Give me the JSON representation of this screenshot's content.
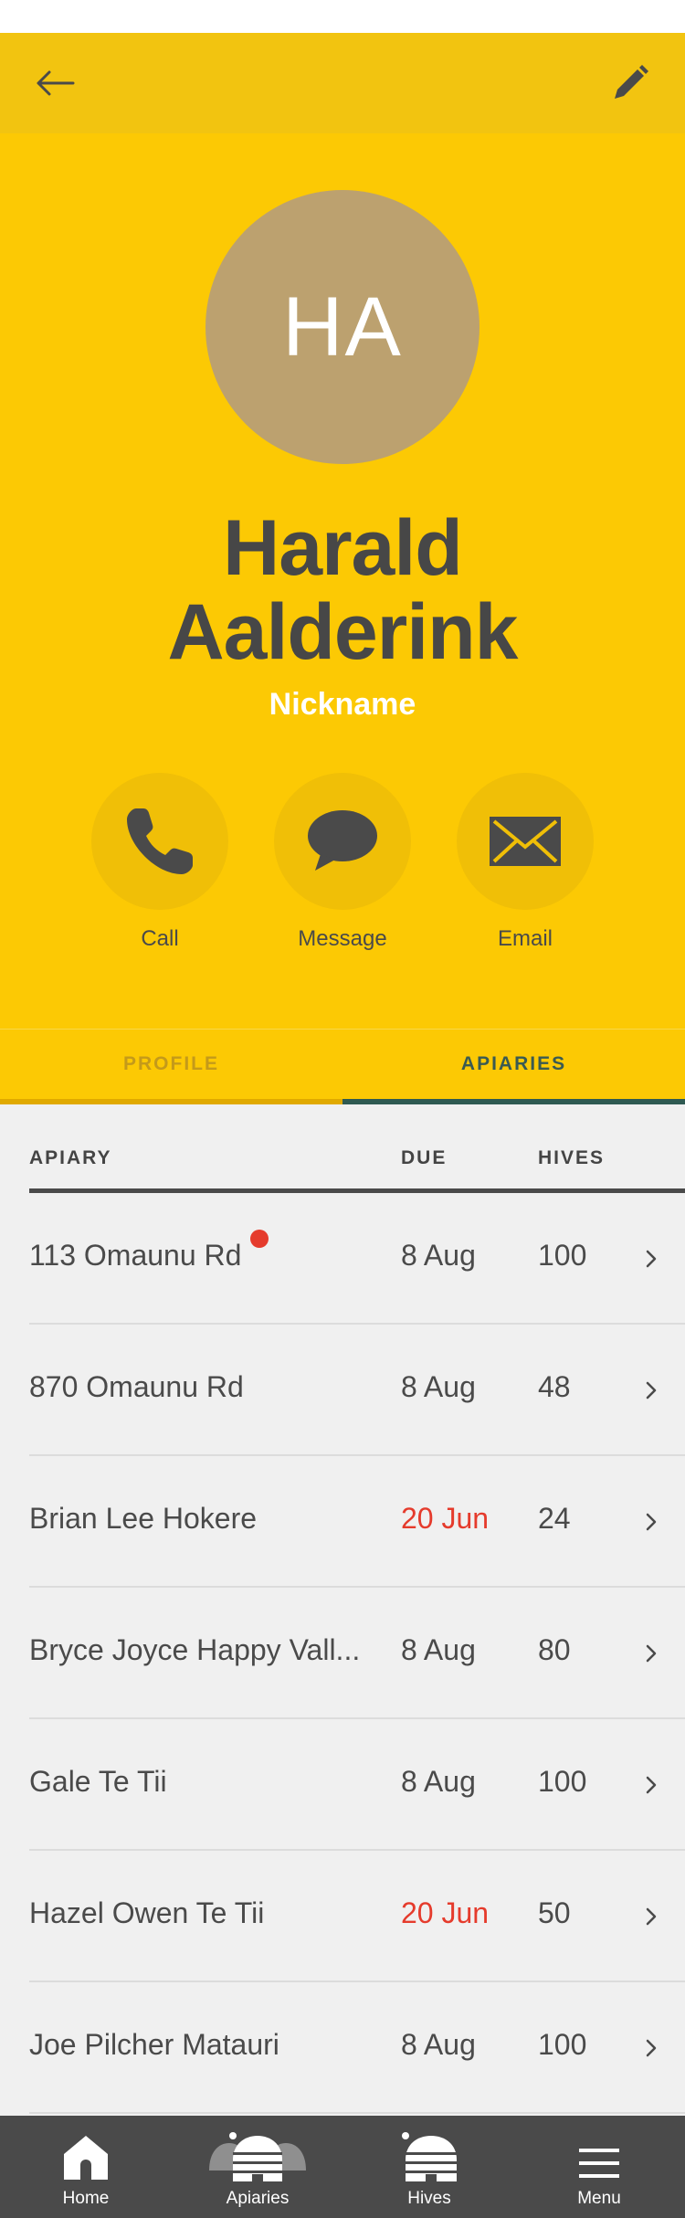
{
  "header": {
    "back_icon": "arrow-left-icon",
    "edit_icon": "pencil-icon"
  },
  "profile": {
    "initials": "HA",
    "first_name": "Harald",
    "last_name": "Aalderink",
    "nickname": "Nickname"
  },
  "actions": [
    {
      "label": "Call",
      "icon": "phone-icon"
    },
    {
      "label": "Message",
      "icon": "speech-bubble-icon"
    },
    {
      "label": "Email",
      "icon": "envelope-icon"
    }
  ],
  "tabs": {
    "profile": "PROFILE",
    "apiaries": "APIARIES",
    "active": "apiaries"
  },
  "table": {
    "columns": {
      "apiary": "APIARY",
      "due": "DUE",
      "hives": "HIVES"
    },
    "rows": [
      {
        "name": "113 Omaunu Rd",
        "due": "8 Aug",
        "hives": "100",
        "overdue": false,
        "alert": true
      },
      {
        "name": "870 Omaunu Rd",
        "due": "8 Aug",
        "hives": "48",
        "overdue": false,
        "alert": false
      },
      {
        "name": "Brian Lee Hokere",
        "due": "20 Jun",
        "hives": "24",
        "overdue": true,
        "alert": false
      },
      {
        "name": "Bryce Joyce Happy Vall...",
        "due": "8 Aug",
        "hives": "80",
        "overdue": false,
        "alert": false
      },
      {
        "name": "Gale Te Tii",
        "due": "8 Aug",
        "hives": "100",
        "overdue": false,
        "alert": false
      },
      {
        "name": "Hazel Owen Te Tii",
        "due": "20 Jun",
        "hives": "50",
        "overdue": true,
        "alert": false
      },
      {
        "name": "Joe Pilcher Matauri",
        "due": "8 Aug",
        "hives": "100",
        "overdue": false,
        "alert": false
      }
    ]
  },
  "nav": {
    "home": "Home",
    "apiaries": "Apiaries",
    "hives": "Hives",
    "menu": "Menu"
  },
  "colors": {
    "brand_yellow": "#fcc904",
    "appbar_yellow": "#f2c410",
    "avatar": "#bca16f",
    "overdue_red": "#e53b2c",
    "dark_text": "#4a4a4a",
    "active_tab": "#2f5a52"
  }
}
